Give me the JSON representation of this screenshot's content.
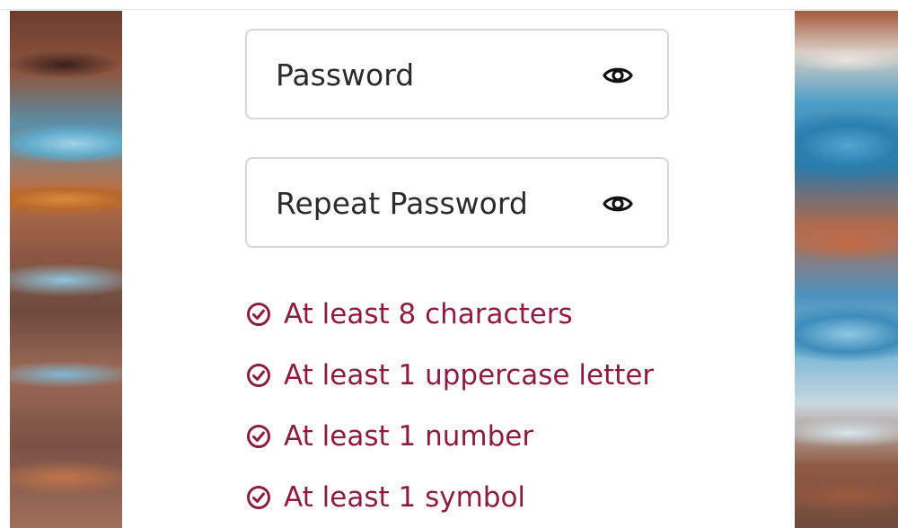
{
  "form": {
    "password": {
      "placeholder": "Password",
      "value": "",
      "toggle_icon": "eye-icon"
    },
    "repeat_password": {
      "placeholder": "Repeat Password",
      "value": "",
      "toggle_icon": "eye-icon"
    }
  },
  "requirements": {
    "icon": "check-circle-icon",
    "color": "#8c1d3e",
    "items": [
      {
        "label": "At least 8 characters"
      },
      {
        "label": "At least 1 uppercase letter"
      },
      {
        "label": "At least 1 number"
      },
      {
        "label": "At least 1 symbol"
      }
    ]
  }
}
